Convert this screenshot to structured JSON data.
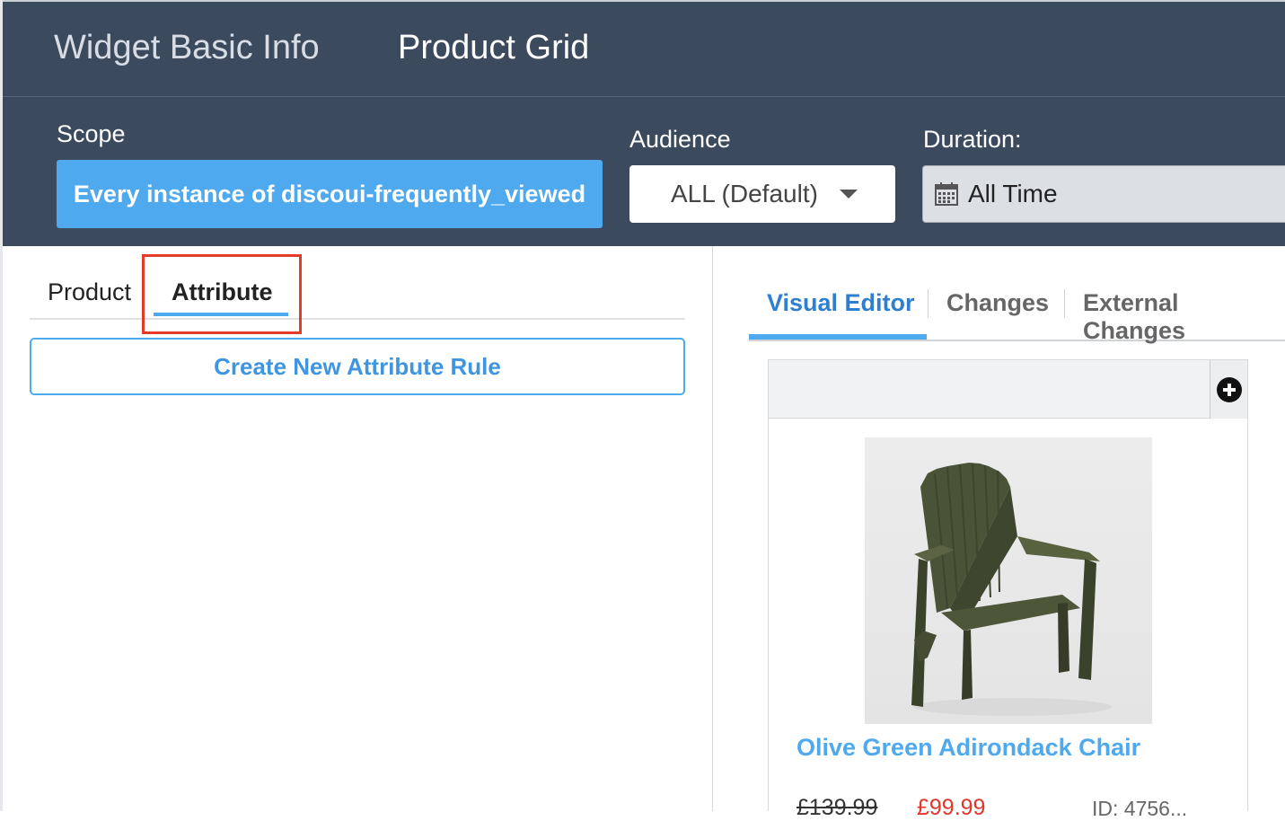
{
  "header": {
    "tabs": [
      "Widget Basic Info",
      "Product Grid"
    ]
  },
  "filters": {
    "scope_label": "Scope",
    "scope_value": "Every instance of discoui-frequently_viewed",
    "audience_label": "Audience",
    "audience_value": "ALL (Default)",
    "duration_label": "Duration:",
    "duration_value": "All Time"
  },
  "left_panel": {
    "tabs": [
      "Product",
      "Attribute"
    ],
    "active_tab": "Attribute",
    "create_button": "Create New Attribute Rule"
  },
  "right_panel": {
    "tabs": [
      "Visual Editor",
      "Changes",
      "External Changes"
    ],
    "active_tab": "Visual Editor",
    "product": {
      "title": "Olive Green Adirondack Chair",
      "price_old": "£139.99",
      "price_new": "£99.99",
      "id": "ID: 4756..."
    }
  },
  "colors": {
    "header_bg": "#3c4a5e",
    "accent": "#4ea9ef",
    "highlight": "#e23b2a",
    "sale_price": "#e0362b"
  },
  "icons": [
    "calendar-icon",
    "caret-down-icon",
    "plus-circle-icon"
  ]
}
